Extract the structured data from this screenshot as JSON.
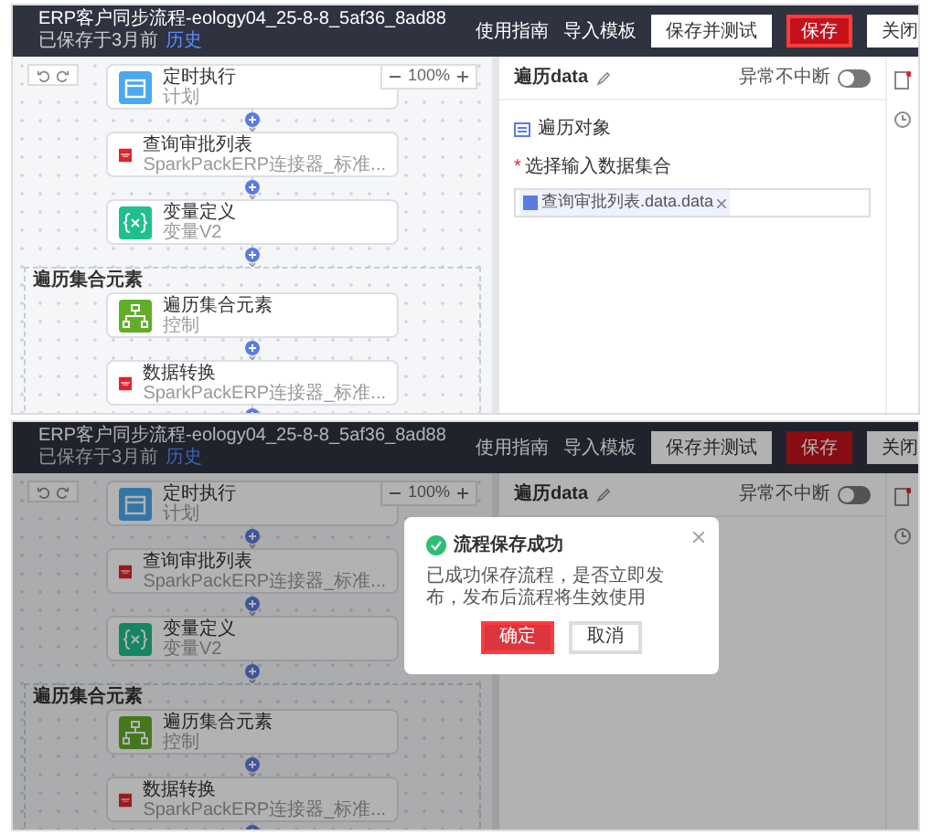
{
  "screens": [
    {
      "top_bar": {
        "title": "ERP客户同步流程-eology04_25-8-8_5af36_8ad88",
        "status": "已保存于3月前",
        "history_link": "历史",
        "links": [
          "使用指南",
          "导入模板"
        ],
        "buttons": [
          {
            "label": "保存并测试",
            "kind": "secondary",
            "highlighted": false
          },
          {
            "label": "保存",
            "kind": "primary",
            "highlighted": true
          },
          {
            "label": "关闭",
            "kind": "secondary",
            "highlighted": false
          }
        ]
      },
      "canvas": {
        "zoom": "100%",
        "nodes": [
          {
            "kind": "schedule",
            "title": "定时执行",
            "subtitle": "计划"
          },
          {
            "kind": "erp",
            "title": "查询审批列表",
            "subtitle": "SparkPackERP连接器_标准..."
          },
          {
            "kind": "variable",
            "title": "变量定义",
            "subtitle": "变量V2"
          }
        ],
        "loop": {
          "label": "遍历集合元素",
          "nodes": [
            {
              "kind": "loop",
              "title": "遍历集合元素",
              "subtitle": "控制"
            },
            {
              "kind": "erp",
              "title": "数据转换",
              "subtitle": "SparkPackERP连接器_标准..."
            }
          ]
        }
      },
      "panel": {
        "title": "遍历data",
        "toggle": {
          "label": "异常不中断",
          "on": false
        },
        "section": "遍历对象",
        "required_mark": "*",
        "field_label": "选择输入数据集合",
        "tag": "查询审批列表.data.data"
      }
    },
    {
      "top_bar": {
        "title": "ERP客户同步流程-eology04_25-8-8_5af36_8ad88",
        "status": "已保存于3月前",
        "history_link": "历史",
        "links": [
          "使用指南",
          "导入模板"
        ],
        "buttons": [
          {
            "label": "保存并测试",
            "kind": "secondary",
            "highlighted": false
          },
          {
            "label": "保存",
            "kind": "primary",
            "highlighted": false
          },
          {
            "label": "关闭",
            "kind": "secondary",
            "highlighted": false
          }
        ]
      },
      "canvas": {
        "zoom": "100%",
        "nodes": [
          {
            "kind": "schedule",
            "title": "定时执行",
            "subtitle": "计划"
          },
          {
            "kind": "erp",
            "title": "查询审批列表",
            "subtitle": "SparkPackERP连接器_标准..."
          },
          {
            "kind": "variable",
            "title": "变量定义",
            "subtitle": "变量V2"
          }
        ],
        "loop": {
          "label": "遍历集合元素",
          "nodes": [
            {
              "kind": "loop",
              "title": "遍历集合元素",
              "subtitle": "控制"
            },
            {
              "kind": "erp",
              "title": "数据转换",
              "subtitle": "SparkPackERP连接器_标准..."
            }
          ]
        }
      },
      "panel": {
        "title": "遍历data",
        "toggle": {
          "label": "异常不中断",
          "on": false
        }
      },
      "modal": {
        "title": "流程保存成功",
        "message": "已成功保存流程，是否立即发布，发布后流程将生效使用",
        "buttons": [
          {
            "label": "确定",
            "kind": "primary",
            "highlighted": true
          },
          {
            "label": "取消",
            "kind": "secondary",
            "highlighted": false
          }
        ]
      }
    }
  ]
}
